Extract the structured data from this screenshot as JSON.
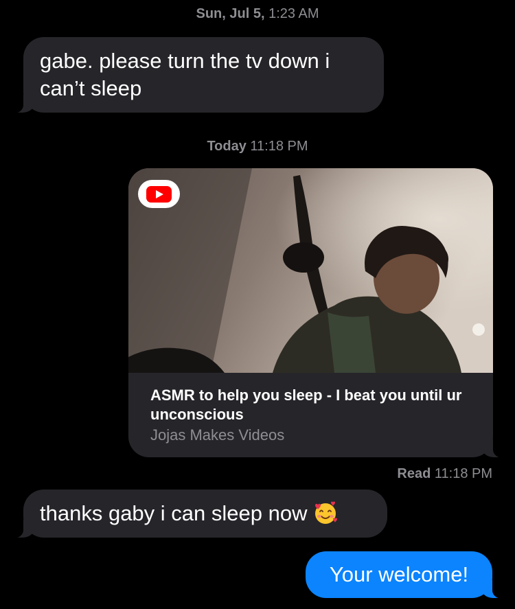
{
  "thread": {
    "timestamp_1": {
      "day": "Sun, Jul 5,",
      "time": "1:23 AM"
    },
    "timestamp_2": {
      "day": "Today",
      "time": "11:18 PM"
    },
    "messages": [
      {
        "direction": "incoming",
        "text": "gabe. please turn the tv down i can’t sleep"
      },
      {
        "direction": "outgoing",
        "type": "link-preview",
        "title": "ASMR to help you sleep - I beat you until ur unconscious",
        "channel": "Jojas Makes Videos",
        "source_icon": "youtube-icon"
      },
      {
        "direction": "incoming",
        "text": "thanks gaby i can sleep now",
        "emoji": "smiling-face-with-hearts-icon"
      },
      {
        "direction": "outgoing",
        "text": "Your welcome!"
      }
    ],
    "read_receipt": {
      "label": "Read",
      "time": "11:18 PM"
    }
  },
  "colors": {
    "background": "#000000",
    "incoming_bubble": "#26252a",
    "outgoing_bubble": "#0b84fe",
    "meta_text": "#8e8e93",
    "youtube_red": "#ff0000"
  }
}
